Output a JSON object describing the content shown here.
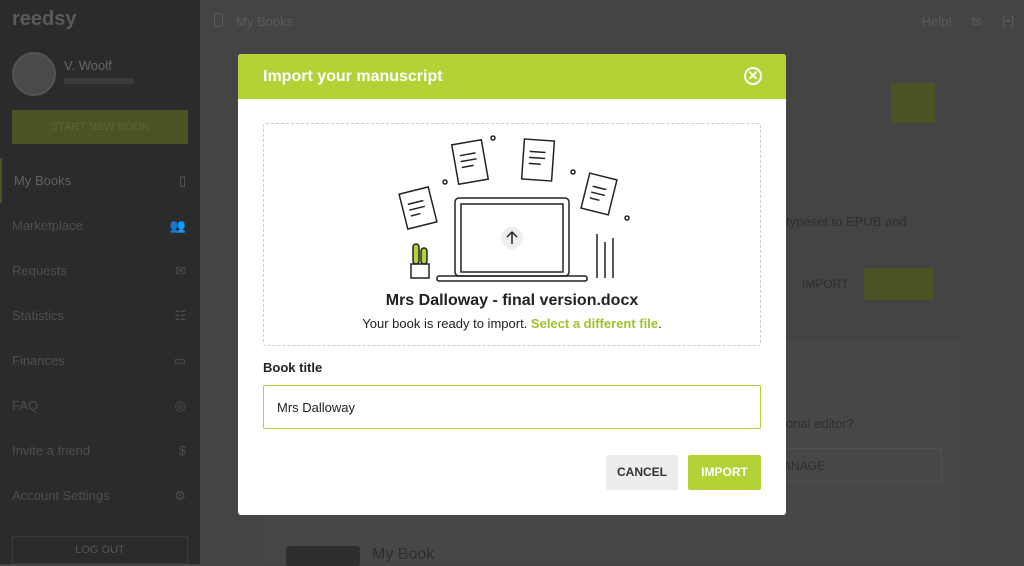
{
  "sidebar": {
    "logo": "reedsy",
    "user_name": "V. Woolf",
    "cta_label": "START NEW BOOK",
    "items": [
      {
        "label": "My Books",
        "icon": "book-icon"
      },
      {
        "label": "Marketplace",
        "icon": "users-icon"
      },
      {
        "label": "Requests",
        "icon": "mail-icon"
      },
      {
        "label": "Statistics",
        "icon": "stats-icon"
      },
      {
        "label": "Finances",
        "icon": "wallet-icon"
      },
      {
        "label": "FAQ",
        "icon": "lifebuoy-icon"
      },
      {
        "label": "Invite a friend",
        "icon": "dollar-icon"
      },
      {
        "label": "Account Settings",
        "icon": "gear-icon"
      }
    ],
    "logout": "LOG OUT"
  },
  "topbar": {
    "title": "My Books",
    "help": "Help!",
    "mail": "✉",
    "other": "[•]"
  },
  "background": {
    "typeset_text": "typeset to EPUB and",
    "import_label": "IMPORT",
    "editor_text": "onal editor?",
    "manage_label": "ANAGE",
    "book_title": "My Book"
  },
  "modal": {
    "title": "Import your manuscript",
    "close": "✕",
    "file_name": "Mrs Dalloway - final version.docx",
    "ready_text": "Your book is ready to import.",
    "select_link": "Select a different file",
    "period": ".",
    "book_title_label": "Book title",
    "book_title_value": "Mrs Dalloway",
    "cancel": "CANCEL",
    "import": "IMPORT",
    "accent": "#b2d236"
  }
}
